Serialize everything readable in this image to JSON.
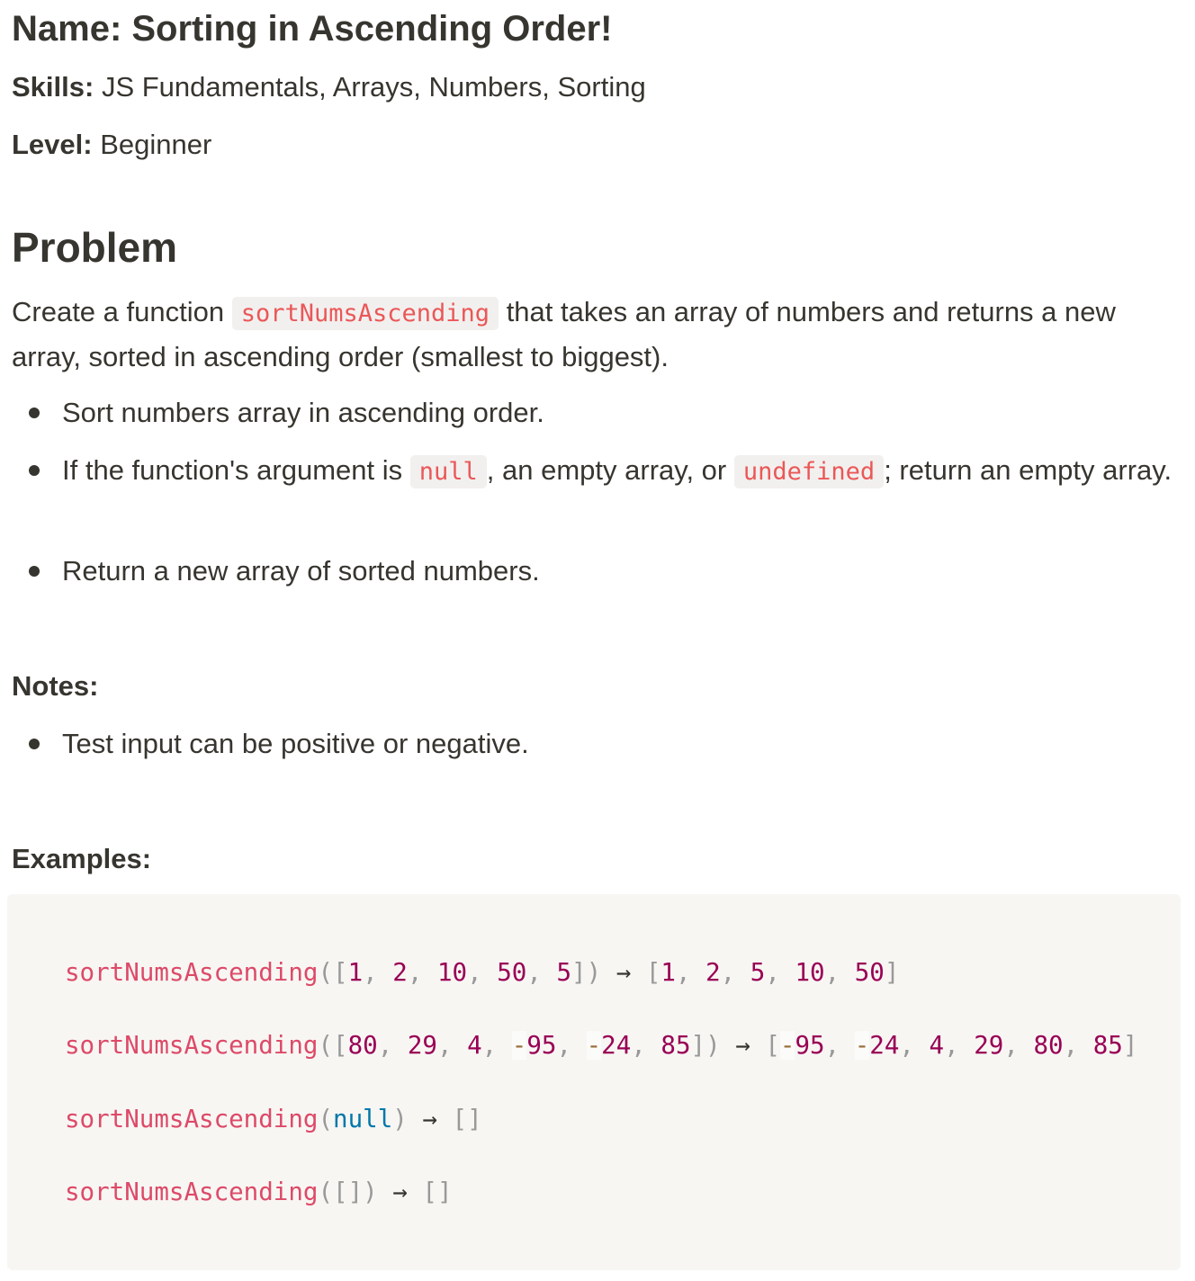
{
  "header": {
    "title": "Name: Sorting in Ascending Order!",
    "skills_label": "Skills:",
    "skills_value": "JS Fundamentals, Arrays, Numbers, Sorting",
    "level_label": "Level:",
    "level_value": "Beginner"
  },
  "problem": {
    "heading": "Problem",
    "intro_before": "Create a function",
    "intro_code": "sortNumsAscending",
    "intro_after": "that takes an array of numbers and returns a new array, sorted in ascending order (smallest to biggest).",
    "bullet1": "Sort numbers array in ascending order.",
    "bullet2_before": "If the function's argument is",
    "bullet2_code1": "null",
    "bullet2_middle": ", an empty array, or",
    "bullet2_code2": "undefined",
    "bullet2_after": "; return an empty array.",
    "bullet3": "Return a new array of sorted numbers."
  },
  "notes": {
    "label": "Notes:",
    "bullet1": "Test input can be positive or negative."
  },
  "examples": {
    "label": "Examples:",
    "fn_name": "sortNumsAscending",
    "arrow": "→",
    "null_kw": "null",
    "ex1": {
      "input": [
        "1",
        "2",
        "10",
        "50",
        "5"
      ],
      "output": [
        "1",
        "2",
        "5",
        "10",
        "50"
      ]
    },
    "ex2": {
      "input": [
        "80",
        "29",
        "4",
        "-95",
        "-24",
        "85"
      ],
      "output": [
        "-95",
        "-24",
        "4",
        "29",
        "80",
        "85"
      ]
    }
  },
  "colors": {
    "text": "#37352f",
    "inline_code": "#eb5757",
    "inline_code_bg": "#f1f0ef",
    "code_block_bg": "#f7f6f3",
    "code_function": "#dd4a68",
    "code_number": "#990055",
    "code_keyword": "#0077aa",
    "code_punctuation": "#999999",
    "code_operator": "#9a6e3a"
  }
}
